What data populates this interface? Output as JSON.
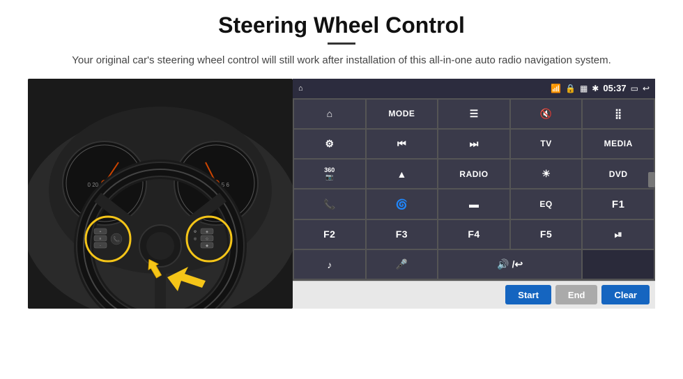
{
  "header": {
    "title": "Steering Wheel Control",
    "subtitle": "Your original car's steering wheel control will still work after installation of this all-in-one auto radio navigation system."
  },
  "status_bar": {
    "time": "05:37",
    "icons": [
      "wifi",
      "lock",
      "sim",
      "bluetooth",
      "battery",
      "screen",
      "back"
    ]
  },
  "grid_buttons": [
    {
      "id": "r1c1",
      "type": "icon",
      "icon": "⌂"
    },
    {
      "id": "r1c2",
      "type": "text",
      "label": "MODE"
    },
    {
      "id": "r1c3",
      "type": "icon",
      "icon": "≡"
    },
    {
      "id": "r1c4",
      "type": "icon",
      "icon": "🔇"
    },
    {
      "id": "r1c5",
      "type": "icon",
      "icon": "⣿"
    },
    {
      "id": "r2c1",
      "type": "icon",
      "icon": "⚙"
    },
    {
      "id": "r2c2",
      "type": "icon",
      "icon": "⏮"
    },
    {
      "id": "r2c3",
      "type": "icon",
      "icon": "⏭"
    },
    {
      "id": "r2c4",
      "type": "text",
      "label": "TV"
    },
    {
      "id": "r2c5",
      "type": "text",
      "label": "MEDIA"
    },
    {
      "id": "r3c1",
      "type": "icon",
      "icon": "📷"
    },
    {
      "id": "r3c2",
      "type": "icon",
      "icon": "▲"
    },
    {
      "id": "r3c3",
      "type": "text",
      "label": "RADIO"
    },
    {
      "id": "r3c4",
      "type": "icon",
      "icon": "☀"
    },
    {
      "id": "r3c5",
      "type": "text",
      "label": "DVD"
    },
    {
      "id": "r4c1",
      "type": "icon",
      "icon": "📞"
    },
    {
      "id": "r4c2",
      "type": "icon",
      "icon": "🌀"
    },
    {
      "id": "r4c3",
      "type": "icon",
      "icon": "▬"
    },
    {
      "id": "r4c4",
      "type": "text",
      "label": "EQ"
    },
    {
      "id": "r4c5",
      "type": "text",
      "label": "F1"
    },
    {
      "id": "r5c1",
      "type": "text",
      "label": "F2"
    },
    {
      "id": "r5c2",
      "type": "text",
      "label": "F3"
    },
    {
      "id": "r5c3",
      "type": "text",
      "label": "F4"
    },
    {
      "id": "r5c4",
      "type": "text",
      "label": "F5"
    },
    {
      "id": "r5c5",
      "type": "icon",
      "icon": "⏯"
    },
    {
      "id": "r6c1",
      "type": "icon",
      "icon": "♪"
    },
    {
      "id": "r6c2",
      "type": "icon",
      "icon": "🎤"
    },
    {
      "id": "r6c3",
      "type": "icon",
      "icon": "🔊"
    },
    {
      "id": "r6c4",
      "type": "text",
      "label": ""
    },
    {
      "id": "r6c5",
      "type": "text",
      "label": ""
    }
  ],
  "action_buttons": {
    "start": "Start",
    "end": "End",
    "clear": "Clear"
  }
}
